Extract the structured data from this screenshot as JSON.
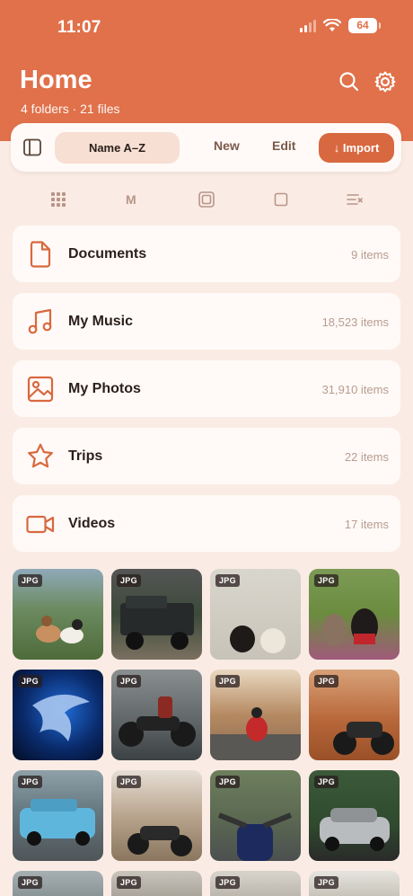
{
  "status_bar": {
    "time": "11:07",
    "battery": "64"
  },
  "header": {
    "title": "Home",
    "subtitle": "4 folders · 21 files"
  },
  "toolbar": {
    "sort_label": "Name A–Z",
    "new_label": "New",
    "edit_label": "Edit",
    "import_label": "↓ Import"
  },
  "view_modes": {
    "medium_label": "M"
  },
  "folders": [
    {
      "name": "Documents",
      "count": "9 items",
      "icon": "document-icon"
    },
    {
      "name": "My Music",
      "count": "18,523 items",
      "icon": "music-note-icon"
    },
    {
      "name": "My Photos",
      "count": "31,910 items",
      "icon": "photo-icon"
    },
    {
      "name": "Trips",
      "count": "22 items",
      "icon": "star-icon"
    },
    {
      "name": "Videos",
      "count": "17 items",
      "icon": "video-camera-icon"
    }
  ],
  "files": [
    {
      "type": "JPG",
      "subject": "two dogs on grass"
    },
    {
      "type": "JPG",
      "subject": "armored off-road truck"
    },
    {
      "type": "JPG",
      "subject": "two puppies on white backdrop"
    },
    {
      "type": "JPG",
      "subject": "two french bulldogs in flowers"
    },
    {
      "type": "JPG",
      "subject": "blue eagle logo"
    },
    {
      "type": "JPG",
      "subject": "rider on black motorcycle"
    },
    {
      "type": "JPG",
      "subject": "motorcyclist in canyon"
    },
    {
      "type": "JPG",
      "subject": "motorcycle in desert"
    },
    {
      "type": "JPG",
      "subject": "police car"
    },
    {
      "type": "JPG",
      "subject": "motorcycle on rocky road"
    },
    {
      "type": "JPG",
      "subject": "motorcycle handlebar view"
    },
    {
      "type": "JPG",
      "subject": "silver hatchback car"
    },
    {
      "type": "JPG",
      "subject": "partial photo"
    },
    {
      "type": "JPG",
      "subject": "partial photo"
    },
    {
      "type": "JPG",
      "subject": "partial photo"
    },
    {
      "type": "JPG",
      "subject": "partial photo"
    }
  ],
  "colors": {
    "accent": "#e0714a",
    "background": "#faece4",
    "card": "#fffaf7"
  }
}
